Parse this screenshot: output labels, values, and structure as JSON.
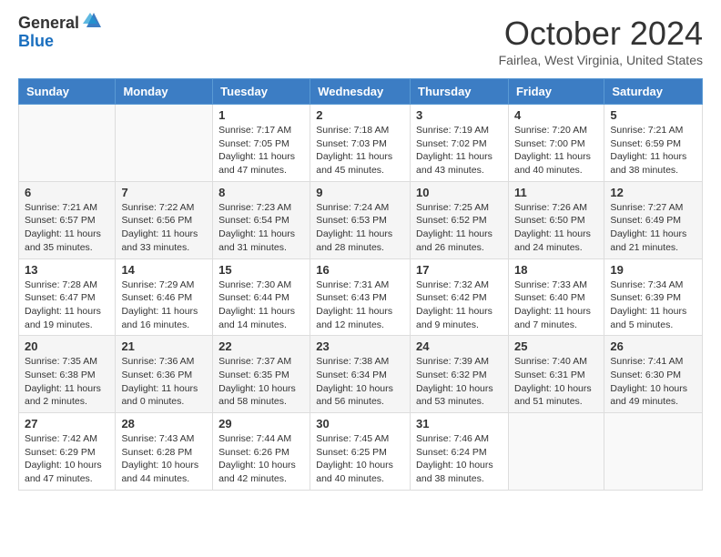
{
  "header": {
    "logo_general": "General",
    "logo_blue": "Blue",
    "month_title": "October 2024",
    "location": "Fairlea, West Virginia, United States"
  },
  "days_of_week": [
    "Sunday",
    "Monday",
    "Tuesday",
    "Wednesday",
    "Thursday",
    "Friday",
    "Saturday"
  ],
  "weeks": [
    [
      {
        "day": "",
        "sunrise": "",
        "sunset": "",
        "daylight": "",
        "empty": true
      },
      {
        "day": "",
        "sunrise": "",
        "sunset": "",
        "daylight": "",
        "empty": true
      },
      {
        "day": "1",
        "sunrise": "Sunrise: 7:17 AM",
        "sunset": "Sunset: 7:05 PM",
        "daylight": "Daylight: 11 hours and 47 minutes."
      },
      {
        "day": "2",
        "sunrise": "Sunrise: 7:18 AM",
        "sunset": "Sunset: 7:03 PM",
        "daylight": "Daylight: 11 hours and 45 minutes."
      },
      {
        "day": "3",
        "sunrise": "Sunrise: 7:19 AM",
        "sunset": "Sunset: 7:02 PM",
        "daylight": "Daylight: 11 hours and 43 minutes."
      },
      {
        "day": "4",
        "sunrise": "Sunrise: 7:20 AM",
        "sunset": "Sunset: 7:00 PM",
        "daylight": "Daylight: 11 hours and 40 minutes."
      },
      {
        "day": "5",
        "sunrise": "Sunrise: 7:21 AM",
        "sunset": "Sunset: 6:59 PM",
        "daylight": "Daylight: 11 hours and 38 minutes."
      }
    ],
    [
      {
        "day": "6",
        "sunrise": "Sunrise: 7:21 AM",
        "sunset": "Sunset: 6:57 PM",
        "daylight": "Daylight: 11 hours and 35 minutes."
      },
      {
        "day": "7",
        "sunrise": "Sunrise: 7:22 AM",
        "sunset": "Sunset: 6:56 PM",
        "daylight": "Daylight: 11 hours and 33 minutes."
      },
      {
        "day": "8",
        "sunrise": "Sunrise: 7:23 AM",
        "sunset": "Sunset: 6:54 PM",
        "daylight": "Daylight: 11 hours and 31 minutes."
      },
      {
        "day": "9",
        "sunrise": "Sunrise: 7:24 AM",
        "sunset": "Sunset: 6:53 PM",
        "daylight": "Daylight: 11 hours and 28 minutes."
      },
      {
        "day": "10",
        "sunrise": "Sunrise: 7:25 AM",
        "sunset": "Sunset: 6:52 PM",
        "daylight": "Daylight: 11 hours and 26 minutes."
      },
      {
        "day": "11",
        "sunrise": "Sunrise: 7:26 AM",
        "sunset": "Sunset: 6:50 PM",
        "daylight": "Daylight: 11 hours and 24 minutes."
      },
      {
        "day": "12",
        "sunrise": "Sunrise: 7:27 AM",
        "sunset": "Sunset: 6:49 PM",
        "daylight": "Daylight: 11 hours and 21 minutes."
      }
    ],
    [
      {
        "day": "13",
        "sunrise": "Sunrise: 7:28 AM",
        "sunset": "Sunset: 6:47 PM",
        "daylight": "Daylight: 11 hours and 19 minutes."
      },
      {
        "day": "14",
        "sunrise": "Sunrise: 7:29 AM",
        "sunset": "Sunset: 6:46 PM",
        "daylight": "Daylight: 11 hours and 16 minutes."
      },
      {
        "day": "15",
        "sunrise": "Sunrise: 7:30 AM",
        "sunset": "Sunset: 6:44 PM",
        "daylight": "Daylight: 11 hours and 14 minutes."
      },
      {
        "day": "16",
        "sunrise": "Sunrise: 7:31 AM",
        "sunset": "Sunset: 6:43 PM",
        "daylight": "Daylight: 11 hours and 12 minutes."
      },
      {
        "day": "17",
        "sunrise": "Sunrise: 7:32 AM",
        "sunset": "Sunset: 6:42 PM",
        "daylight": "Daylight: 11 hours and 9 minutes."
      },
      {
        "day": "18",
        "sunrise": "Sunrise: 7:33 AM",
        "sunset": "Sunset: 6:40 PM",
        "daylight": "Daylight: 11 hours and 7 minutes."
      },
      {
        "day": "19",
        "sunrise": "Sunrise: 7:34 AM",
        "sunset": "Sunset: 6:39 PM",
        "daylight": "Daylight: 11 hours and 5 minutes."
      }
    ],
    [
      {
        "day": "20",
        "sunrise": "Sunrise: 7:35 AM",
        "sunset": "Sunset: 6:38 PM",
        "daylight": "Daylight: 11 hours and 2 minutes."
      },
      {
        "day": "21",
        "sunrise": "Sunrise: 7:36 AM",
        "sunset": "Sunset: 6:36 PM",
        "daylight": "Daylight: 11 hours and 0 minutes."
      },
      {
        "day": "22",
        "sunrise": "Sunrise: 7:37 AM",
        "sunset": "Sunset: 6:35 PM",
        "daylight": "Daylight: 10 hours and 58 minutes."
      },
      {
        "day": "23",
        "sunrise": "Sunrise: 7:38 AM",
        "sunset": "Sunset: 6:34 PM",
        "daylight": "Daylight: 10 hours and 56 minutes."
      },
      {
        "day": "24",
        "sunrise": "Sunrise: 7:39 AM",
        "sunset": "Sunset: 6:32 PM",
        "daylight": "Daylight: 10 hours and 53 minutes."
      },
      {
        "day": "25",
        "sunrise": "Sunrise: 7:40 AM",
        "sunset": "Sunset: 6:31 PM",
        "daylight": "Daylight: 10 hours and 51 minutes."
      },
      {
        "day": "26",
        "sunrise": "Sunrise: 7:41 AM",
        "sunset": "Sunset: 6:30 PM",
        "daylight": "Daylight: 10 hours and 49 minutes."
      }
    ],
    [
      {
        "day": "27",
        "sunrise": "Sunrise: 7:42 AM",
        "sunset": "Sunset: 6:29 PM",
        "daylight": "Daylight: 10 hours and 47 minutes."
      },
      {
        "day": "28",
        "sunrise": "Sunrise: 7:43 AM",
        "sunset": "Sunset: 6:28 PM",
        "daylight": "Daylight: 10 hours and 44 minutes."
      },
      {
        "day": "29",
        "sunrise": "Sunrise: 7:44 AM",
        "sunset": "Sunset: 6:26 PM",
        "daylight": "Daylight: 10 hours and 42 minutes."
      },
      {
        "day": "30",
        "sunrise": "Sunrise: 7:45 AM",
        "sunset": "Sunset: 6:25 PM",
        "daylight": "Daylight: 10 hours and 40 minutes."
      },
      {
        "day": "31",
        "sunrise": "Sunrise: 7:46 AM",
        "sunset": "Sunset: 6:24 PM",
        "daylight": "Daylight: 10 hours and 38 minutes."
      },
      {
        "day": "",
        "sunrise": "",
        "sunset": "",
        "daylight": "",
        "empty": true
      },
      {
        "day": "",
        "sunrise": "",
        "sunset": "",
        "daylight": "",
        "empty": true
      }
    ]
  ]
}
